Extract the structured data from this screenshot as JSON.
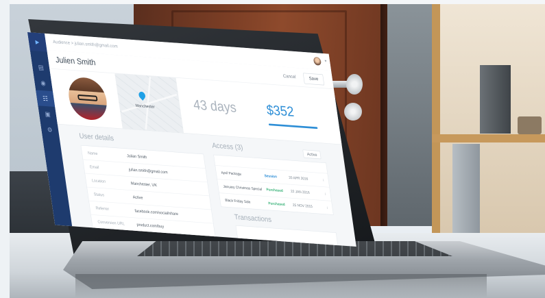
{
  "app": {
    "breadcrumb": "Audience > julian.smith@gmail.com",
    "title": "Julien Smith",
    "actions": {
      "cancel": "Cancel",
      "save": "Save"
    },
    "sidebar_icons": [
      "logo-icon",
      "chart-icon",
      "camera-icon",
      "contacts-icon",
      "inbox-icon",
      "settings-icon"
    ]
  },
  "hero": {
    "map_label": "Manchester",
    "stat_days": {
      "value": "43 days"
    },
    "stat_spend": {
      "value": "$352"
    }
  },
  "user_details": {
    "title": "User details",
    "rows": [
      {
        "label": "Name",
        "value": "Julian Smith"
      },
      {
        "label": "Email",
        "value": "julian.smith@gmail.com"
      },
      {
        "label": "Location",
        "value": "Manchester, UK"
      },
      {
        "label": "Status",
        "value": "Active"
      },
      {
        "label": "Referrer",
        "value": "facebook.com/social/share"
      },
      {
        "label": "Conversion URL",
        "value": "product.com/buy"
      }
    ]
  },
  "access": {
    "title": "Access (3)",
    "filter": "Active",
    "rows": [
      {
        "name": "April Package",
        "type": "Session",
        "type_color": "#2d8ed6",
        "date": "20 APR 2016"
      },
      {
        "name": "January Christmas Special",
        "type": "Purchased",
        "type_color": "#3bb37a",
        "date": "22 JAN 2016"
      },
      {
        "name": "Black Friday Sale",
        "type": "Purchased",
        "type_color": "#3bb37a",
        "date": "25 NOV 2015"
      }
    ]
  },
  "transactions": {
    "title": "Transactions"
  }
}
